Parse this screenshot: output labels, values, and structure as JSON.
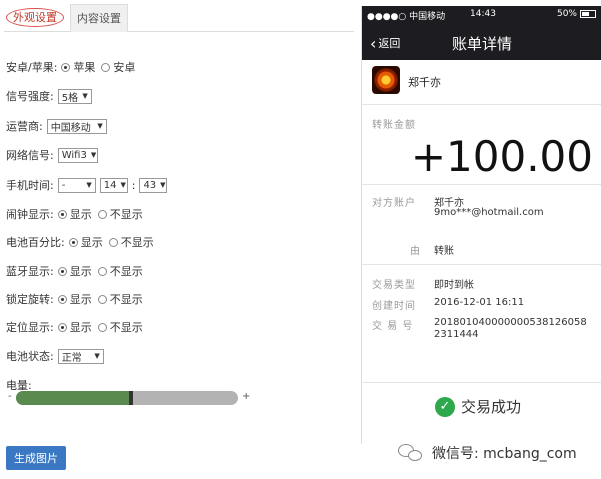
{
  "tabs": {
    "appearance": "外观设置",
    "content": "内容设置"
  },
  "settings": {
    "platform": {
      "label": "安卓/苹果:",
      "options": [
        "苹果",
        "安卓"
      ],
      "selected": 0
    },
    "signal": {
      "label": "信号强度:",
      "value": "5格"
    },
    "carrier": {
      "label": "运营商:",
      "value": "中国移动"
    },
    "network": {
      "label": "网络信号:",
      "value": "Wifi3"
    },
    "phone_time": {
      "label": "手机时间:",
      "ampm": "-",
      "hour": "14",
      "minute": "43"
    },
    "alarm": {
      "label": "闹钟显示:",
      "on": "显示",
      "off": "不显示"
    },
    "battery_pct": {
      "label": "电池百分比:",
      "on": "显示",
      "off": "不显示"
    },
    "bluetooth": {
      "label": "蓝牙显示:",
      "on": "显示",
      "off": "不显示"
    },
    "rotation_lock": {
      "label": "锁定旋转:",
      "on": "显示",
      "off": "不显示"
    },
    "location": {
      "label": "定位显示:",
      "on": "显示",
      "off": "不显示"
    },
    "battery_state": {
      "label": "电池状态:",
      "value": "正常"
    },
    "battery_level": {
      "label": "电量:",
      "minus": "-",
      "plus": "+",
      "fraction": 0.52
    }
  },
  "generate_button": "生成图片",
  "phone": {
    "status": {
      "carrier": "●●●●○ 中国移动",
      "time": "14:43",
      "battery": "50%"
    },
    "nav": {
      "back": "返回",
      "title": "账单详情"
    },
    "payee": "郑千亦",
    "amount_label": "转账金额",
    "amount": "+100.00",
    "counterparty_label": "对方账户",
    "counterparty_name": "郑千亦",
    "counterparty_email": "9mo***@hotmail.com",
    "reason_label": "由",
    "reason_value": "转账",
    "type_label": "交易类型",
    "type_value": "即时到帐",
    "created_label": "创建时间",
    "created_value": "2016-12-01 16:11",
    "txid_label": "交  易  号",
    "txid_line1": "201801040000000538126058",
    "txid_line2": "2311444",
    "success": "交易成功"
  },
  "watermark": "微信号: mcbang_com"
}
